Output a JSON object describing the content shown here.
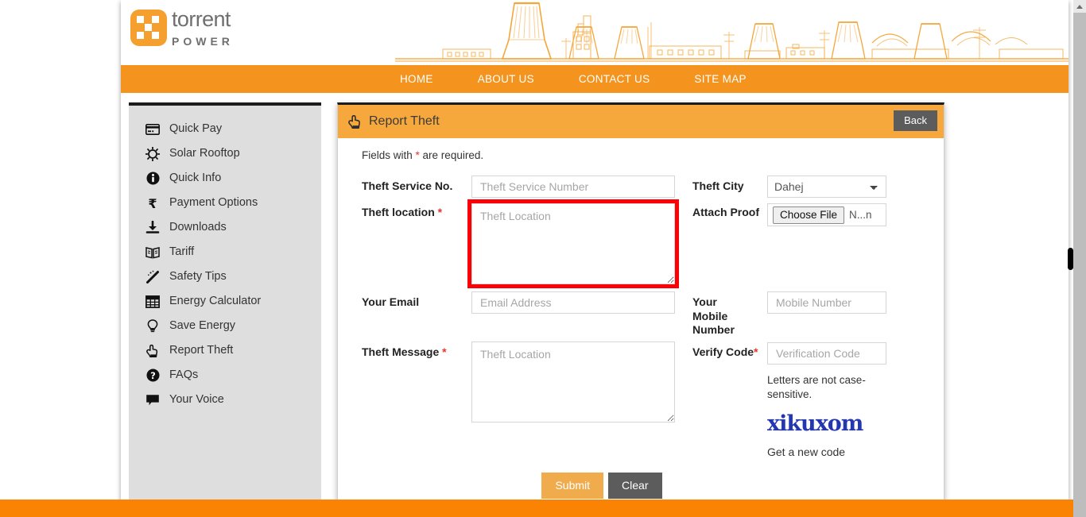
{
  "brand": {
    "name_primary": "torrent",
    "name_secondary": "POWER",
    "accent_color": "#f4941e",
    "logo_color": "#f5a02e",
    "banner_alt": "power-plant-skyline"
  },
  "nav": {
    "items": [
      {
        "label": "HOME"
      },
      {
        "label": "ABOUT US"
      },
      {
        "label": "CONTACT US"
      },
      {
        "label": "SITE MAP"
      }
    ]
  },
  "sidebar": {
    "items": [
      {
        "label": "Quick Pay",
        "icon": "credit-card-icon"
      },
      {
        "label": "Solar Rooftop",
        "icon": "sun-icon"
      },
      {
        "label": "Quick Info",
        "icon": "info-icon"
      },
      {
        "label": "Payment Options",
        "icon": "rupee-icon"
      },
      {
        "label": "Downloads",
        "icon": "download-icon"
      },
      {
        "label": "Tariff",
        "icon": "book-icon"
      },
      {
        "label": "Safety Tips",
        "icon": "magic-wand-icon"
      },
      {
        "label": "Energy Calculator",
        "icon": "table-grid-icon"
      },
      {
        "label": "Save Energy",
        "icon": "lightbulb-icon"
      },
      {
        "label": "Report Theft",
        "icon": "pointing-hand-icon"
      },
      {
        "label": "FAQs",
        "icon": "question-circle-icon"
      },
      {
        "label": "Your Voice",
        "icon": "speech-bubble-icon"
      }
    ]
  },
  "panel": {
    "title": "Report Theft",
    "title_icon": "pointing-hand-icon",
    "back_label": "Back",
    "required_note_pre": "Fields with ",
    "required_note_star": "*",
    "required_note_post": " are required."
  },
  "form": {
    "theft_service_no": {
      "label": "Theft Service No.",
      "placeholder": "Theft Service Number",
      "value": "",
      "required": false
    },
    "theft_location": {
      "label": "Theft location ",
      "star": "*",
      "placeholder": "Theft Location",
      "value": "",
      "required": true,
      "highlighted": true,
      "highlight_color": "#fb0006"
    },
    "your_email": {
      "label": "Your Email",
      "placeholder": "Email Address",
      "value": "",
      "required": false
    },
    "theft_message": {
      "label": "Theft Message ",
      "star": "*",
      "placeholder": "Theft Location",
      "value": "",
      "required": true
    },
    "theft_city": {
      "label": "Theft City",
      "selected": "Dahej",
      "options": [
        "Dahej"
      ]
    },
    "attach_proof": {
      "label": "Attach Proof",
      "button_label": "Choose File",
      "file_name": "N...n"
    },
    "your_mobile_number": {
      "label": "Your Mobile Number",
      "placeholder": "Mobile Number",
      "value": "",
      "required": false
    },
    "verify_code": {
      "label": "Verify Code",
      "star": "*",
      "placeholder": "Verification Code",
      "value": "",
      "required": true
    },
    "captcha": {
      "hint": "Letters are not case-sensitive.",
      "code_text": "xikuxom",
      "code_color": "#2237b0",
      "refresh_label": "Get a new code"
    },
    "actions": {
      "submit_label": "Submit",
      "clear_label": "Clear"
    }
  },
  "footer": {
    "bar_color": "#fb8304"
  }
}
